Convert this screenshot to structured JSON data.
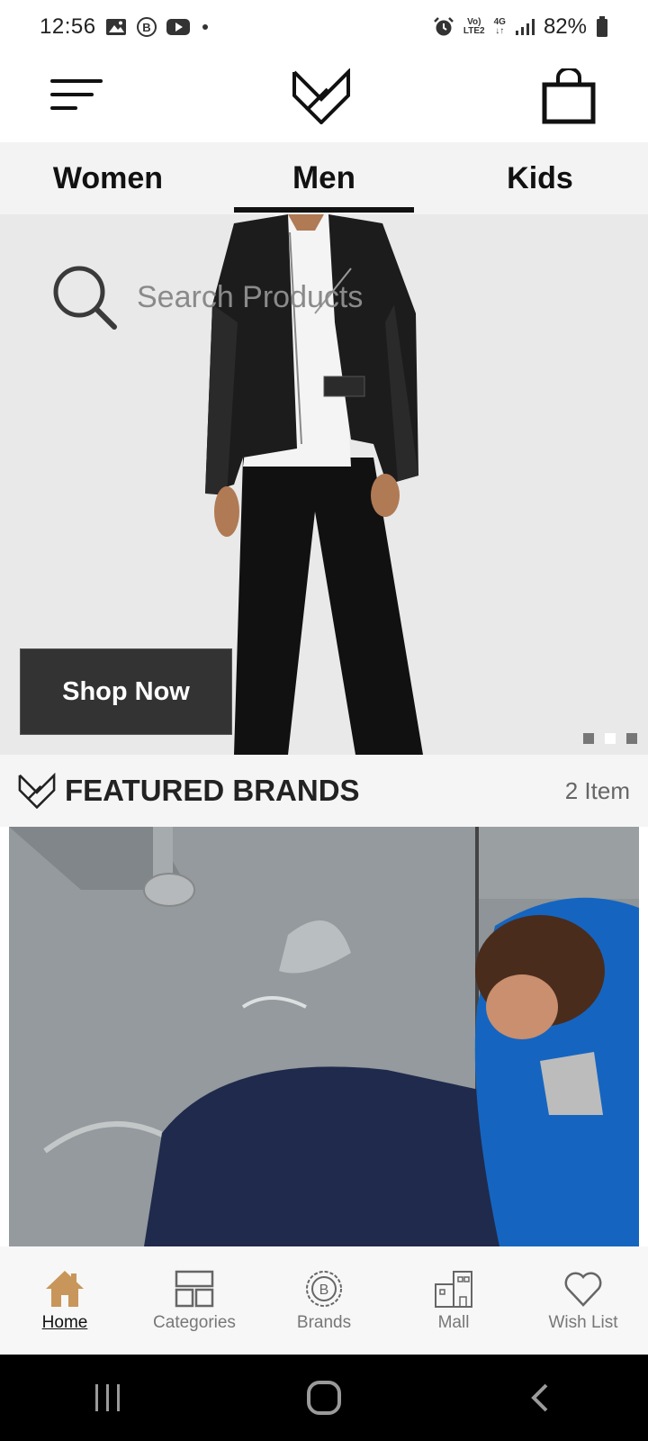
{
  "status_bar": {
    "time": "12:56",
    "network_top": "Vo)",
    "network_bottom": "LTE2",
    "data_top": "4G",
    "battery": "82%",
    "icons": [
      "gallery-icon",
      "b-circle-icon",
      "youtube-icon",
      "alarm-icon",
      "signal-icon",
      "battery-icon"
    ]
  },
  "header": {
    "icons": [
      "menu-icon",
      "logo-icon",
      "shopping-bag-icon"
    ]
  },
  "tabs": [
    {
      "label": "Women"
    },
    {
      "label": "Men",
      "active": true
    },
    {
      "label": "Kids"
    }
  ],
  "hero": {
    "search_placeholder": "Search Products",
    "cta": "Shop Now",
    "slides": 3,
    "active_slide": 2
  },
  "featured": {
    "title": "FEATURED BRANDS",
    "count": "2 Item"
  },
  "bottom_nav": [
    {
      "label": "Home",
      "icon": "home-icon",
      "active": true
    },
    {
      "label": "Categories",
      "icon": "categories-icon"
    },
    {
      "label": "Brands",
      "icon": "brands-icon"
    },
    {
      "label": "Mall",
      "icon": "mall-icon"
    },
    {
      "label": "Wish List",
      "icon": "heart-icon"
    }
  ],
  "colors": {
    "accent": "#c8965a",
    "dark_button": "#333333",
    "tab_bar": "#f3f3f3"
  }
}
